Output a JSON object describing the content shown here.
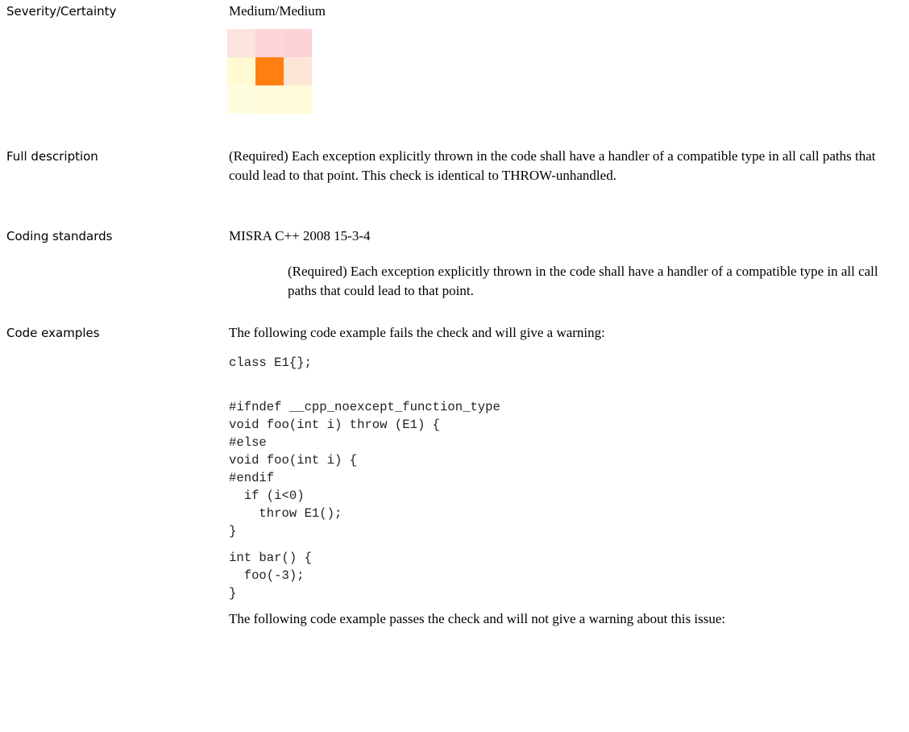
{
  "severity": {
    "label": "Severity/Certainty",
    "value": "Medium/Medium",
    "matrix_colors": [
      [
        "#fde4df",
        "#fdd5d9",
        "#fdd2d6"
      ],
      [
        "#fffad0",
        "#ff8010",
        "#fde6d6"
      ],
      [
        "#fffde0",
        "#fffbd8",
        "#fffbd8"
      ]
    ]
  },
  "full_description": {
    "label": "Full description",
    "text": " (Required) Each exception explicitly thrown in the code shall have a handler of a compatible type in all call paths that could lead to that point. This check is identical to THROW-unhandled."
  },
  "coding_standards": {
    "label": "Coding standards",
    "standard": "MISRA C++ 2008 15-3-4",
    "detail": "(Required) Each exception explicitly thrown in the code shall have a handler of a compatible type in all call paths that could lead to that point."
  },
  "code_examples": {
    "label": "Code examples",
    "fail_intro": "The following code example fails the check and will give a warning:",
    "fail_code_1": "class E1{};",
    "fail_code_2": "#ifndef __cpp_noexcept_function_type\nvoid foo(int i) throw (E1) {\n#else\nvoid foo(int i) {\n#endif\n  if (i<0)\n    throw E1();\n}",
    "fail_code_3": "int bar() {\n  foo(-3);\n}",
    "pass_intro": "The following code example passes the check and will not give a warning about this issue:"
  }
}
